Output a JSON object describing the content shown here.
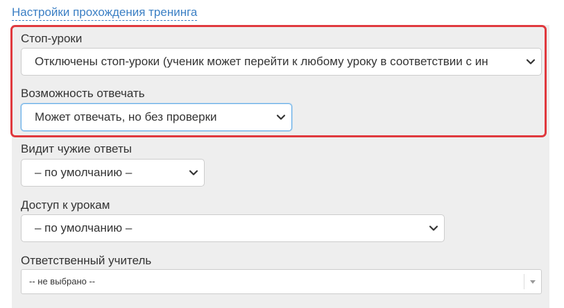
{
  "section_link": "Настройки прохождения тренинга",
  "fields": {
    "stop_lessons": {
      "label": "Стоп-уроки",
      "value": "Отключены стоп-уроки (ученик может перейти к любому уроку в соответствии с ин"
    },
    "answer_ability": {
      "label": "Возможность отвечать",
      "value": "Может отвечать, но без проверки"
    },
    "see_others_answers": {
      "label": "Видит чужие ответы",
      "value": "– по умолчанию –"
    },
    "lesson_access": {
      "label": "Доступ к урокам",
      "value": "– по умолчанию –"
    },
    "responsible_teacher": {
      "label": "Ответственный учитель",
      "value": "-- не выбрано --"
    }
  },
  "colors": {
    "link": "#3b7fc4",
    "highlight_border": "#e0393e",
    "panel_bg": "#eeeeee",
    "focus_border": "#66afe9"
  },
  "icons": {
    "select_arrow": "chevron-down-icon",
    "select2_arrow": "triangle-down-icon"
  }
}
